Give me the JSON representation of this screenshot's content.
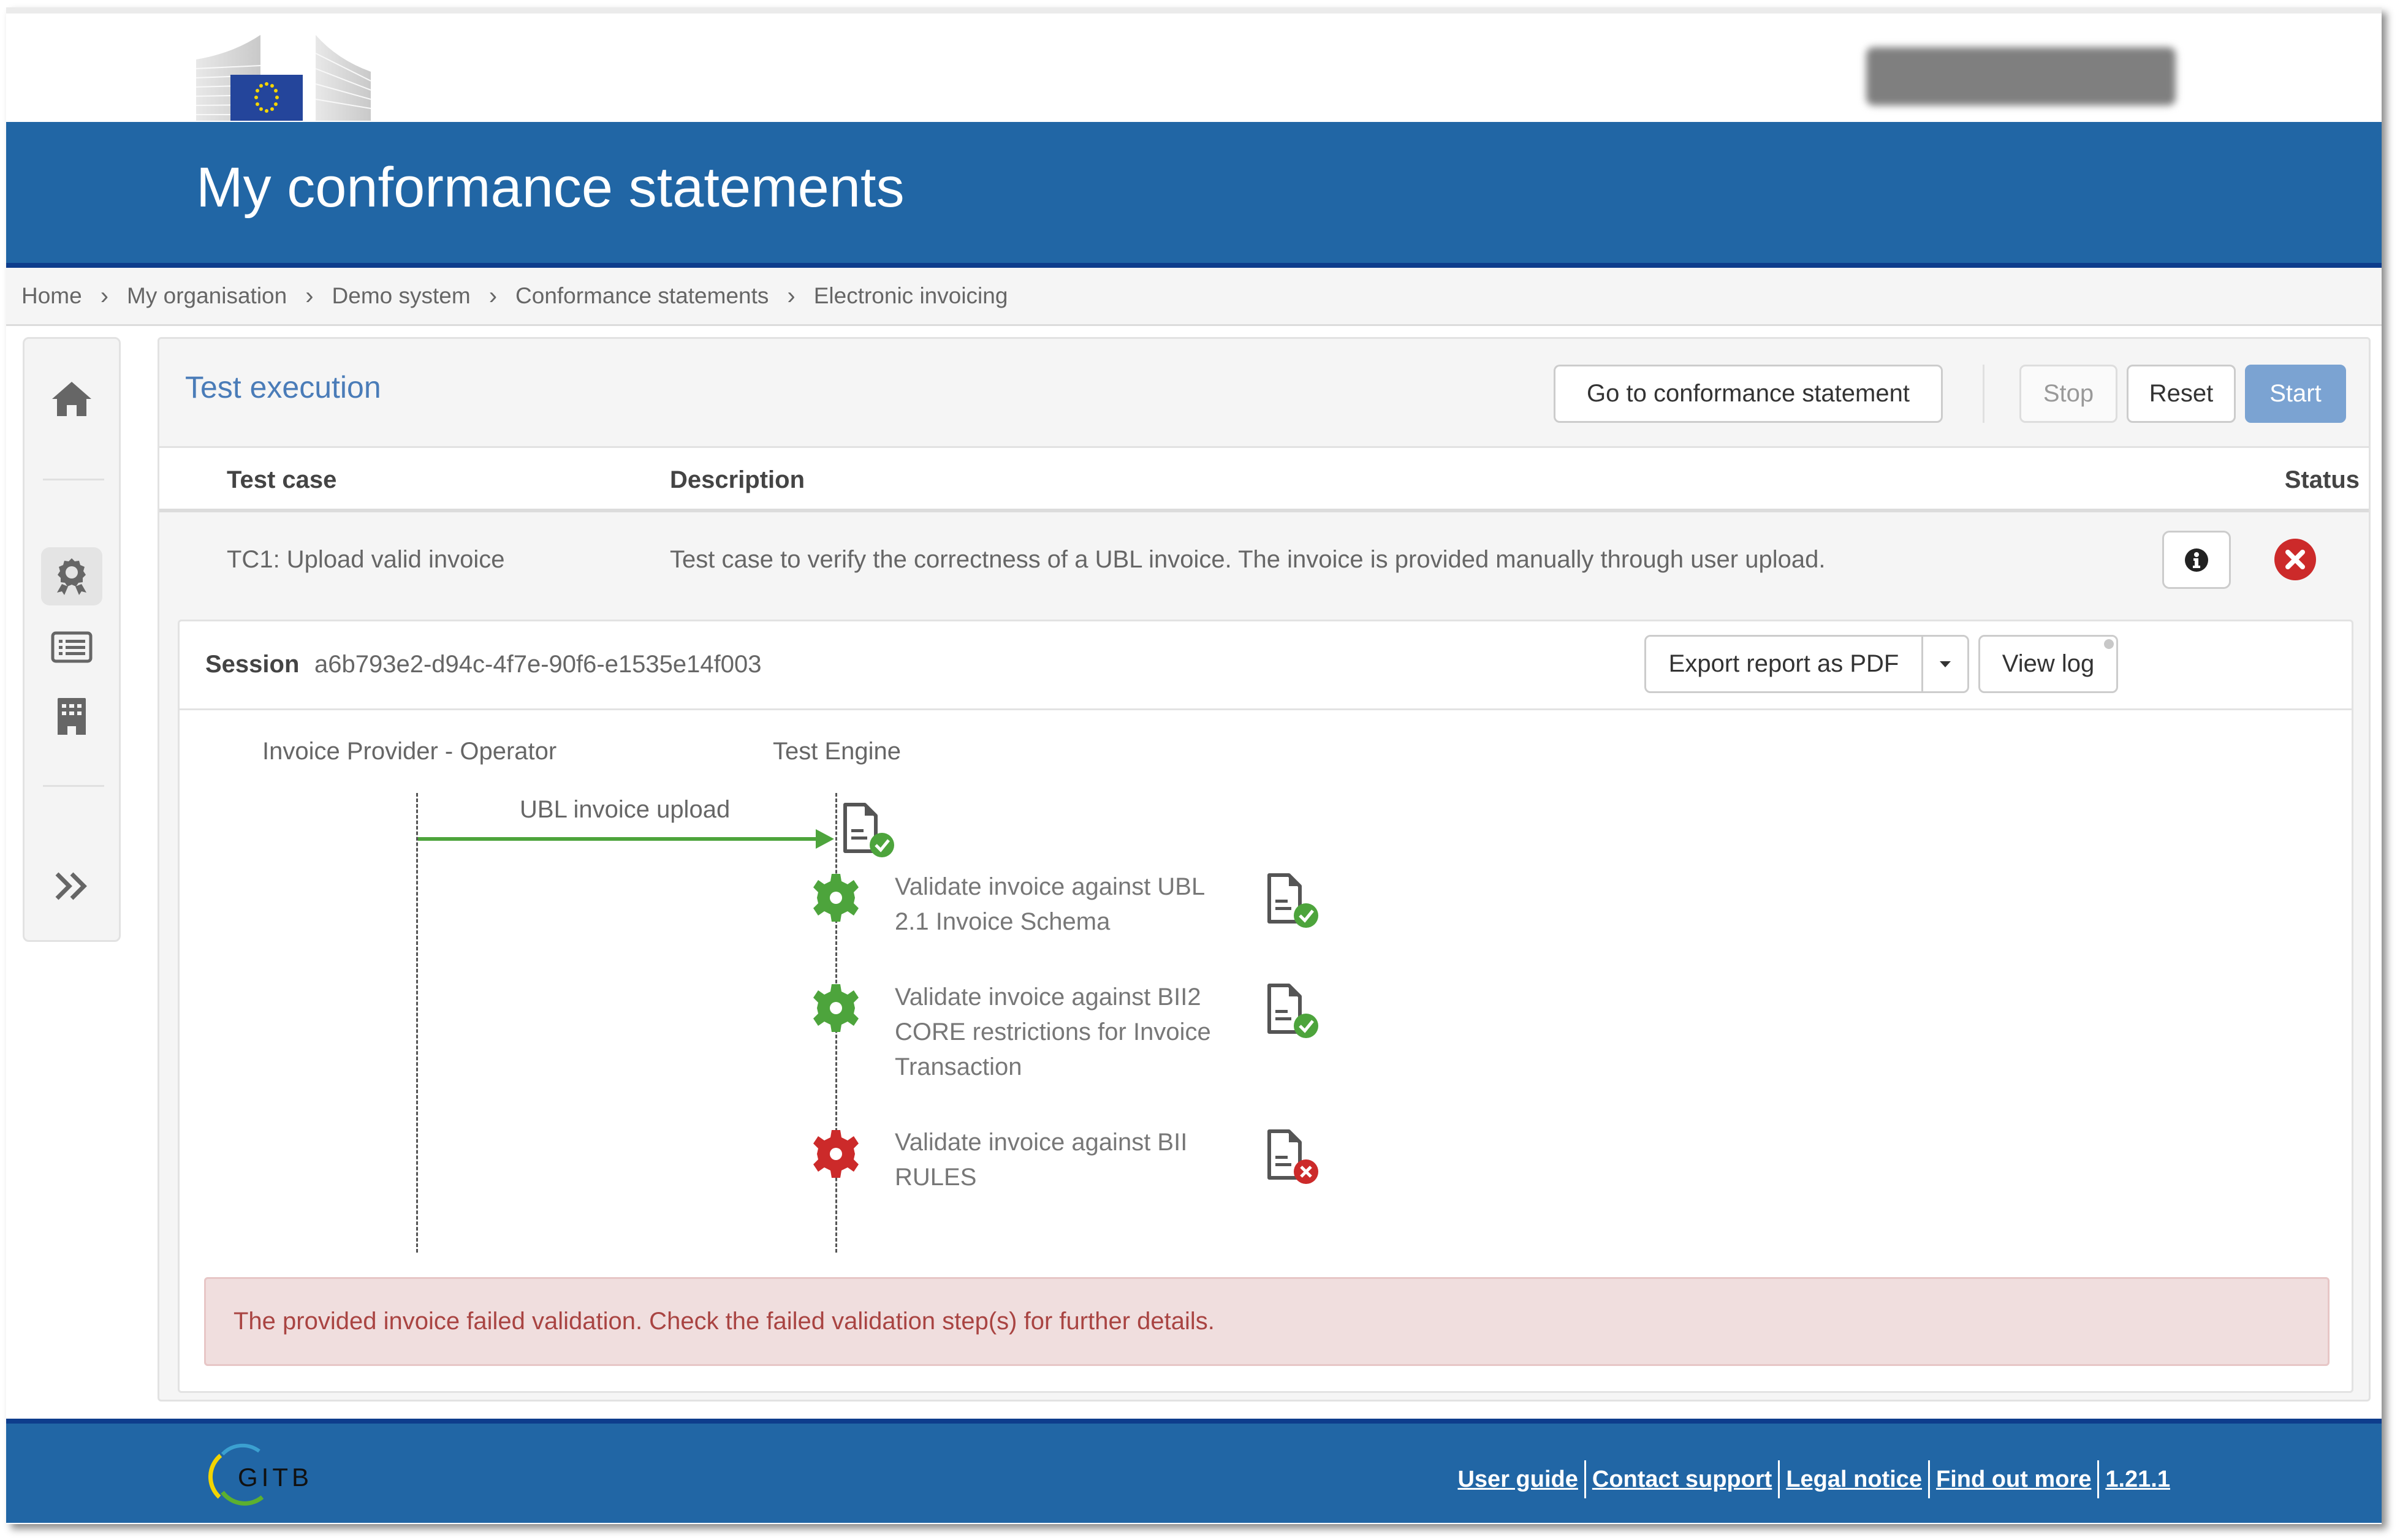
{
  "header": {
    "title": "My conformance statements",
    "logo": "european-commission-logo",
    "user_menu": "blurred-user-name"
  },
  "breadcrumb": [
    "Home",
    "My organisation",
    "Demo system",
    "Conformance statements",
    "Electronic invoicing"
  ],
  "sidebar": {
    "items": [
      {
        "icon": "home-icon",
        "label": "Home"
      },
      {
        "icon": "certificate-icon",
        "label": "Conformance statements",
        "active": true
      },
      {
        "icon": "list-icon",
        "label": "Test sessions"
      },
      {
        "icon": "building-icon",
        "label": "Organisation"
      },
      {
        "icon": "double-chevron-right-icon",
        "label": "Expand"
      }
    ]
  },
  "panel": {
    "title": "Test execution",
    "buttons": {
      "go_to_statement": "Go to conformance statement",
      "stop": "Stop",
      "reset": "Reset",
      "start": "Start"
    },
    "table": {
      "headers": [
        "Test case",
        "Description",
        "Status"
      ],
      "rows": [
        {
          "test_case": "TC1: Upload valid invoice",
          "description": "Test case to verify the correctness of a UBL invoice. The invoice is provided manually through user upload.",
          "status": "failed"
        }
      ]
    }
  },
  "session": {
    "label": "Session",
    "id": "a6b793e2-d94c-4f7e-90f6-e1535e14f003",
    "export_label": "Export report as PDF",
    "view_log_label": "View log"
  },
  "diagram": {
    "actors": [
      "Invoice Provider - Operator",
      "Test Engine"
    ],
    "message": {
      "label": "UBL invoice upload",
      "status": "success"
    },
    "steps": [
      {
        "lines": [
          "Validate invoice against UBL",
          "2.1 Invoice Schema"
        ],
        "status": "success"
      },
      {
        "lines": [
          "Validate invoice against BII2",
          "CORE restrictions for Invoice",
          "Transaction"
        ],
        "status": "success"
      },
      {
        "lines": [
          "Validate invoice against BII",
          "RULES"
        ],
        "status": "error"
      }
    ]
  },
  "alert": {
    "message": "The provided invoice failed validation. Check the failed validation step(s) for further details."
  },
  "footer": {
    "logo": "GITB",
    "links": [
      "User guide",
      "Contact support",
      "Legal notice",
      "Find out more",
      "1.21.1"
    ]
  },
  "colors": {
    "brand_blue": "#2166a5",
    "success": "#4da43c",
    "error": "#cc2a2a",
    "alert_bg": "#f0dede",
    "alert_text": "#a94442",
    "primary_button": "#7ba3d2"
  }
}
